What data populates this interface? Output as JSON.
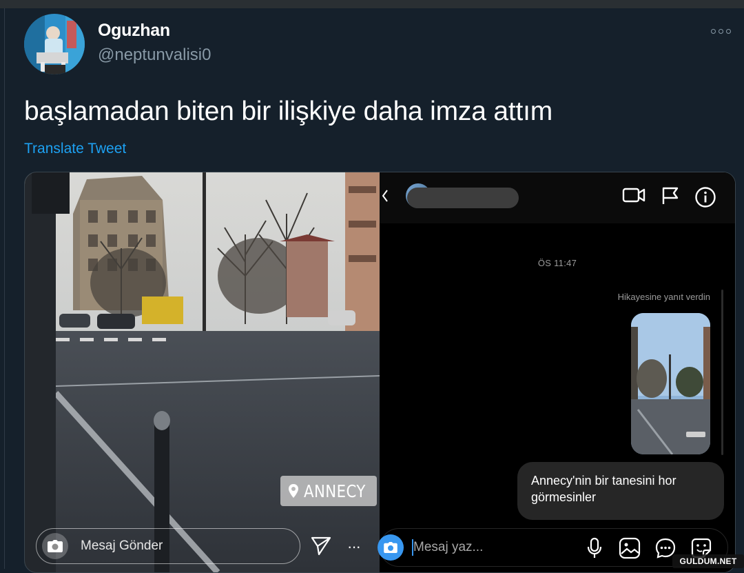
{
  "tweet": {
    "author_name": "Oguzhan",
    "author_handle": "@neptunvalisi0",
    "text": "başlamadan biten bir ilişkiye daha imza attım",
    "translate_label": "Translate Tweet",
    "more_icon": "more-dots-icon"
  },
  "story": {
    "location_sticker": "ANNECY",
    "send_placeholder": "Mesaj Gönder",
    "more_label": "···",
    "icons": [
      "camera-icon",
      "paper-plane-icon",
      "location-pin-icon"
    ]
  },
  "dm": {
    "header_icons": [
      "video-call-icon",
      "flag-icon",
      "info-icon"
    ],
    "timestamp": "ÖS 11:47",
    "replied_label": "Hikayesine yanıt verdin",
    "message": "Annecy'nin bir tanesini hor görmesinler",
    "input_placeholder": "Mesaj yaz...",
    "input_icons": [
      "microphone-icon",
      "gallery-icon",
      "chat-bubble-icon",
      "sticker-icon"
    ],
    "accent_color": "#3897f0"
  },
  "watermark": "GULDUM.NET",
  "colors": {
    "background": "#15202b",
    "link": "#1da1f2",
    "secondary_text": "#8899a6"
  }
}
